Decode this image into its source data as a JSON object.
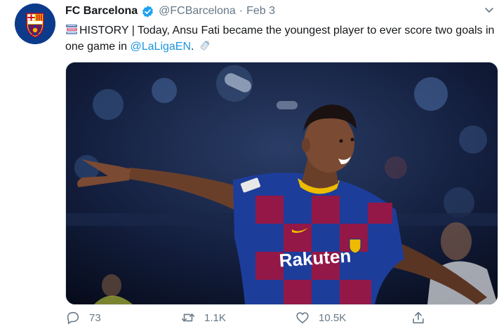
{
  "tweet": {
    "author_name": "FC Barcelona",
    "handle": "@FCBarcelona",
    "separator": "·",
    "date": "Feb 3",
    "text_before": "HISTORY | Today, Ansu Fati became the youngest player to ever score two goals in one game in ",
    "mention": "@LaLigaEN",
    "text_after": ".",
    "emoji_start": "books-emoji-icon",
    "emoji_end": "baby-bottle-emoji-icon",
    "avatar_logo_text": "FCB",
    "media_alt": "Player in blue and maroon striped kit celebrating with arms outstretched",
    "shirt_sponsor": "Rakuten"
  },
  "actions": {
    "reply_count": "73",
    "retweet_count": "1.1K",
    "like_count": "10.5K"
  },
  "colors": {
    "link": "#1b95e0",
    "muted": "#657786",
    "verified": "#1da1f2",
    "club_blue": "#0d3b8c",
    "club_maroon": "#a50044"
  }
}
